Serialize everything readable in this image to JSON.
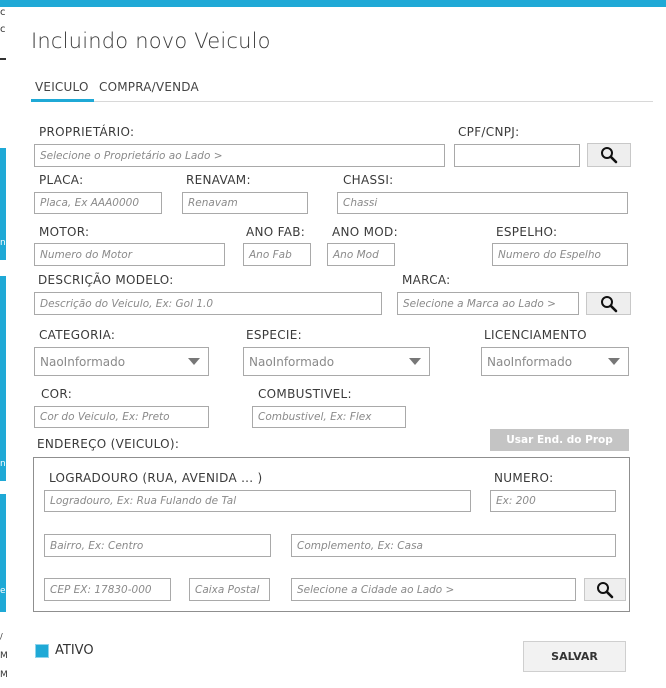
{
  "window": {
    "title": "Incluindo novo Veiculo"
  },
  "tabs": [
    {
      "label": "VEICULO",
      "active": true
    },
    {
      "label": "COMPRA/VENDA",
      "active": false
    }
  ],
  "colors": {
    "accent": "#1fa9d6",
    "disabled_button": "#c4c4c4"
  },
  "left_fragments": [
    "c",
    "c",
    "n",
    "n",
    "e",
    "/",
    "M",
    "M"
  ],
  "form": {
    "proprietario": {
      "label": "PROPRIETÁRIO:",
      "placeholder": "Selecione o Proprietário ao Lado >"
    },
    "cpf_cnpj": {
      "label": "CPF/CNPJ:",
      "value": ""
    },
    "placa": {
      "label": "PLACA:",
      "placeholder": "Placa, Ex AAA0000"
    },
    "renavam": {
      "label": "RENAVAM:",
      "placeholder": "Renavam"
    },
    "chassi": {
      "label": "CHASSI:",
      "placeholder": "Chassi"
    },
    "motor": {
      "label": "MOTOR:",
      "placeholder": "Numero do Motor"
    },
    "ano_fab": {
      "label": "ANO FAB:",
      "placeholder": "Ano Fab"
    },
    "ano_mod": {
      "label": "ANO MOD:",
      "placeholder": "Ano Mod"
    },
    "espelho": {
      "label": "ESPELHO:",
      "placeholder": "Numero do Espelho"
    },
    "descricao_modelo": {
      "label": "DESCRIÇÃO MODELO:",
      "placeholder": "Descrição do Veiculo, Ex: Gol 1.0"
    },
    "marca": {
      "label": "MARCA:",
      "placeholder": "Selecione a Marca ao Lado >"
    },
    "categoria": {
      "label": "CATEGORIA:",
      "selected": "NaoInformado"
    },
    "especie": {
      "label": "ESPECIE:",
      "selected": "NaoInformado"
    },
    "licenciamento": {
      "label": "LICENCIAMENTO",
      "selected": "NaoInformado"
    },
    "cor": {
      "label": "COR:",
      "placeholder": "Cor do Veiculo, Ex: Preto"
    },
    "combustivel": {
      "label": "COMBUSTIVEL:",
      "placeholder": "Combustivel, Ex: Flex"
    },
    "endereco": {
      "label": "ENDEREÇO (VEICULO):",
      "use_prop_button": "Usar End. do Prop",
      "logradouro": {
        "label": "LOGRADOURO (RUA, AVENIDA ... )",
        "placeholder": "Logradouro, Ex: Rua Fulando de Tal"
      },
      "numero": {
        "label": "NUMERO:",
        "placeholder": "Ex: 200"
      },
      "bairro": {
        "placeholder": "Bairro, Ex: Centro"
      },
      "complemento": {
        "placeholder": "Complemento, Ex: Casa"
      },
      "cep": {
        "placeholder": "CEP EX: 17830-000"
      },
      "caixa_postal": {
        "placeholder": "Caixa Postal"
      },
      "cidade": {
        "placeholder": "Selecione a Cidade ao Lado >"
      }
    },
    "ativo": {
      "label": "ATIVO",
      "checked": true
    }
  },
  "actions": {
    "save": "SALVAR"
  },
  "icons": {
    "search": "search-icon",
    "dropdown": "chevron-down-icon"
  }
}
